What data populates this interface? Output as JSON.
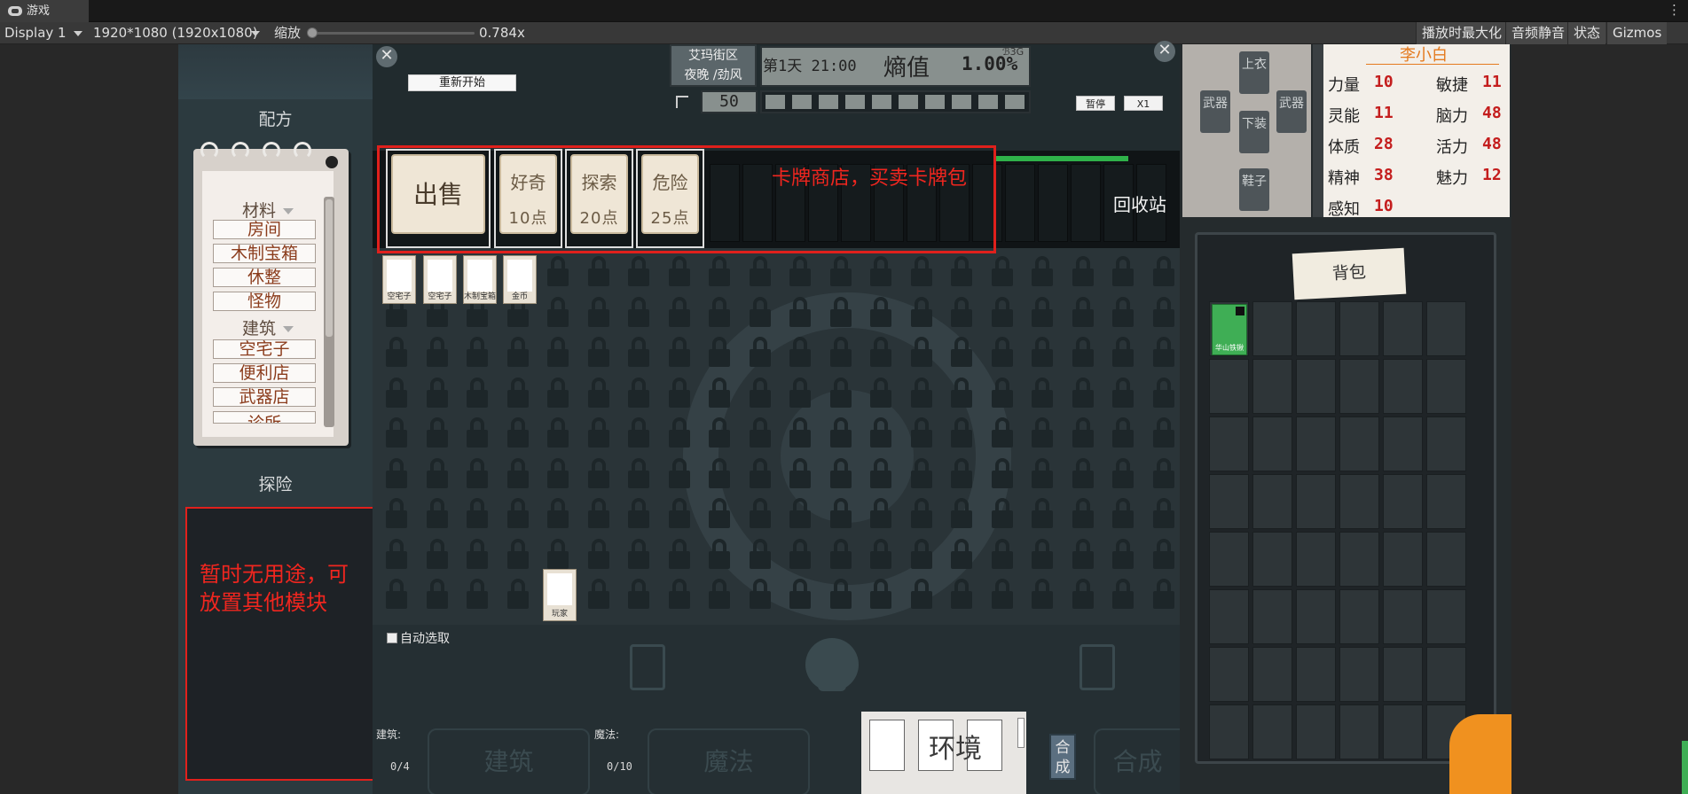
{
  "window": {
    "tab_title": "游戏"
  },
  "toolbar": {
    "display": "Display 1",
    "resolution": "1920*1080 (1920x1080)",
    "scale_label": "缩放",
    "scale_value": "0.784x",
    "maximize_label": "播放时最大化",
    "mute_label": "音频静音",
    "stats_label": "状态",
    "gizmos_label": "Gizmos"
  },
  "left_panel": {
    "recipe_title": "配方",
    "explore_title": "探险",
    "recipe_groups": [
      {
        "label": "材料",
        "items": [
          "房间",
          "木制宝箱",
          "休整",
          "怪物"
        ]
      },
      {
        "label": "建筑",
        "items": [
          "空宅子",
          "便利店",
          "武器店",
          "诊所"
        ]
      }
    ],
    "unused_note": "暂时无用途，可放置其他模块"
  },
  "hud": {
    "close_symbol": "✕",
    "restart_label": "重新开始",
    "location_line1": "艾玛街区",
    "location_line2": "夜晚 /劲风",
    "day_time": "第1天 21:00",
    "entropy_label": "熵值",
    "entropy_value": "1.00%",
    "entropy_unit": "ℬ3G",
    "counter": "50",
    "pause_label": "暂停",
    "speed_label": "X1",
    "progress_cells": 10,
    "recycle_label": "回收站",
    "shop_note": "卡牌商店，买卖卡牌包"
  },
  "shop": {
    "sell_label": "出售",
    "packs": [
      {
        "name": "好奇",
        "cost": "10点"
      },
      {
        "name": "探索",
        "cost": "20点"
      },
      {
        "name": "危险",
        "cost": "25点"
      }
    ]
  },
  "deck_cards": [
    "空宅子",
    "空宅子",
    "木制宝箱",
    "金币"
  ],
  "board_card": "玩家",
  "bottom": {
    "autopick_label": "自动选取",
    "building_label": "建筑:",
    "building_count": "0/4",
    "building_slot": "建筑",
    "magic_label": "魔法:",
    "magic_count": "0/10",
    "magic_slot": "魔法",
    "environment_label": "环境",
    "craft_label": "合成",
    "craft_ghost": "合成"
  },
  "character": {
    "name": "李小白",
    "equip_slots": [
      "上衣",
      "武器",
      "武器",
      "下装",
      "鞋子"
    ],
    "stats": [
      {
        "label": "力量",
        "value": "10"
      },
      {
        "label": "敏捷",
        "value": "11"
      },
      {
        "label": "灵能",
        "value": "11"
      },
      {
        "label": "脑力",
        "value": "48"
      },
      {
        "label": "体质",
        "value": "28"
      },
      {
        "label": "活力",
        "value": "48"
      },
      {
        "label": "精神",
        "value": "38"
      },
      {
        "label": "魅力",
        "value": "12"
      },
      {
        "label": "感知",
        "value": "10"
      }
    ]
  },
  "backpack": {
    "label": "背包",
    "item": "华山铁锹"
  },
  "colors": {
    "annotation_red": "#e0201c",
    "stat_red": "#c41d1d",
    "name_orange": "#e47a1e",
    "progress_green": "#2fb24a"
  }
}
